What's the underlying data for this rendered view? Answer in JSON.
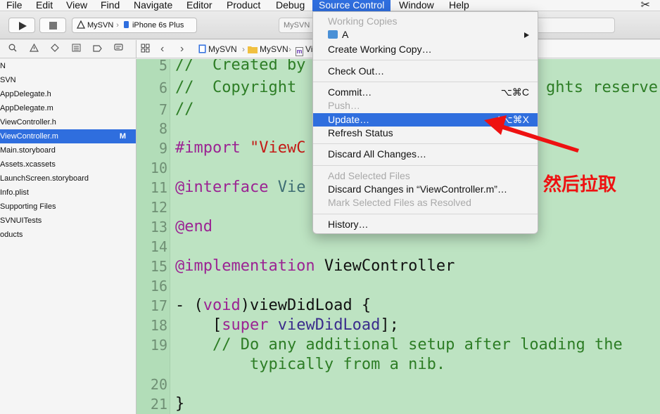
{
  "menubar": {
    "items": [
      "File",
      "Edit",
      "View",
      "Find",
      "Navigate",
      "Editor",
      "Product",
      "Debug",
      "Source Control",
      "Window",
      "Help"
    ],
    "active": "Source Control"
  },
  "toolbar": {
    "scheme_project": "MySVN",
    "scheme_device": "iPhone 6s Plus",
    "status_text": "MySVN"
  },
  "jumpbar": {
    "crumbs": [
      "MySVN",
      "MySVN",
      "Vi"
    ]
  },
  "navigator": {
    "items": [
      {
        "label": "N",
        "status": ""
      },
      {
        "label": "SVN",
        "status": ""
      },
      {
        "label": "AppDelegate.h",
        "status": ""
      },
      {
        "label": "AppDelegate.m",
        "status": ""
      },
      {
        "label": "ViewController.h",
        "status": ""
      },
      {
        "label": "ViewController.m",
        "status": "M"
      },
      {
        "label": "Main.storyboard",
        "status": ""
      },
      {
        "label": "Assets.xcassets",
        "status": ""
      },
      {
        "label": "LaunchScreen.storyboard",
        "status": ""
      },
      {
        "label": "Info.plist",
        "status": ""
      },
      {
        "label": "Supporting Files",
        "status": ""
      },
      {
        "label": "SVNUITests",
        "status": ""
      },
      {
        "label": "oducts",
        "status": ""
      }
    ],
    "selected_index": 5
  },
  "editor": {
    "line_numbers": [
      "5",
      "6",
      "7",
      "8",
      "9",
      "10",
      "11",
      "12",
      "13",
      "14",
      "15",
      "16",
      "17",
      "18",
      "19",
      "20",
      "21"
    ],
    "lines": {
      "l5": "//  Created by",
      "l6": "//  Copyright",
      "l6_tail": "ghts reserve",
      "l7": "//",
      "l9_directive": "#import",
      "l9_string": " \"ViewC",
      "l11_keyword": "@interface",
      "l11_class": " Vie",
      "l13_keyword": "@end",
      "l15_keyword": "@implementation",
      "l15_name": " ViewController",
      "l17_a": "- (",
      "l17_void": "void",
      "l17_b": ")viewDidLoad {",
      "l18_a": "    [",
      "l18_super": "super",
      "l18_space": " ",
      "l18_method": "viewDidLoad",
      "l18_b": "];",
      "l19": "    // Do any additional setup after loading the",
      "l19_cont": "        typically from a nib.",
      "l21": "}"
    }
  },
  "dropdown": {
    "working_copies": "Working Copies",
    "repo": "A",
    "create_working_copy": "Create Working Copy…",
    "check_out": "Check Out…",
    "commit": "Commit…",
    "commit_shortcut": "⌥⌘C",
    "push": "Push…",
    "update": "Update…",
    "update_shortcut": "^⌥⌘X",
    "refresh_status": "Refresh Status",
    "discard_all": "Discard All Changes…",
    "add_selected": "Add Selected Files",
    "discard_changes_in": "Discard Changes in “ViewController.m”…",
    "mark_resolved": "Mark Selected Files as Resolved",
    "history": "History…"
  },
  "annotation": {
    "text": "然后拉取",
    "color": "#ee1111"
  },
  "colors": {
    "accent": "#2f6ede",
    "editor_bg": "#bde3c2",
    "comment": "#2d7d25",
    "keyword": "#9b2393",
    "string": "#c41a16"
  },
  "icons": {
    "scissors": "scissors-icon"
  }
}
